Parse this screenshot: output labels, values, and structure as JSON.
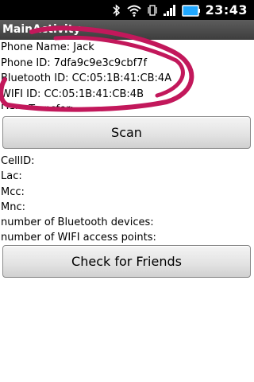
{
  "status_bar": {
    "time": "23:43"
  },
  "title": "MainActivity",
  "info": [
    "Phone Name: Jack",
    "Phone ID: 7dfa9c9e3c9cbf7f",
    "Bluetooth ID: CC:05:1B:41:CB:4A",
    "WIFI ID: CC:05:1B:41:CB:4B",
    "Data Transfer:"
  ],
  "scan_button": "Scan",
  "cell_info": [
    "CellID:",
    "Lac:",
    "Mcc:",
    "Mnc:",
    "number of Bluetooth devices:",
    "number of WIFI access points:"
  ],
  "check_button": "Check for Friends",
  "colors": {
    "annotation": "#c2185b",
    "title_bar": "#4a4a4a"
  }
}
